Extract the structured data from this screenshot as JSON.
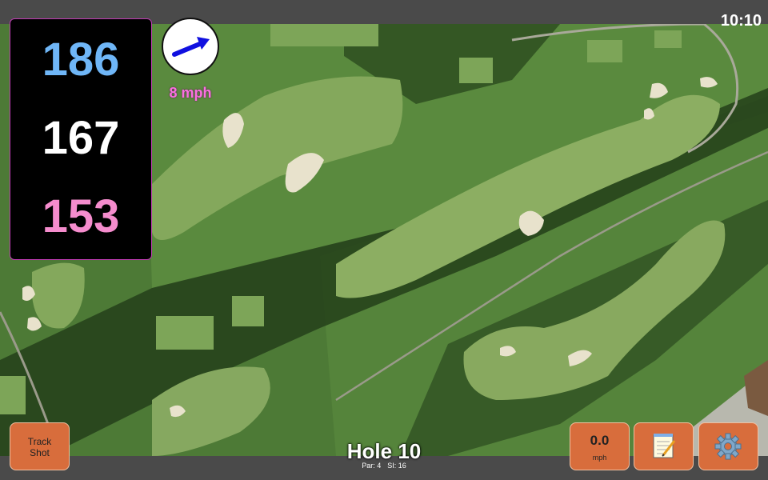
{
  "status_bar": {
    "time": "10:10"
  },
  "distances": {
    "back": "186",
    "middle": "167",
    "front": "153"
  },
  "wind": {
    "speed_label": "8 mph",
    "direction_icon": "arrow-icon",
    "arrow_color": "#1010e0"
  },
  "hole": {
    "title": "Hole 10",
    "par_label": "Par: 4",
    "si_label": "SI: 16"
  },
  "buttons": {
    "track_shot_line1": "Track",
    "track_shot_line2": "Shot",
    "speed_value": "0.0",
    "speed_unit": "mph",
    "notes_icon": "notepad-icon",
    "settings_icon": "gear-icon"
  },
  "colors": {
    "back_distance": "#6fb6f7",
    "middle_distance": "#ffffff",
    "front_distance": "#f58ccd",
    "button_bg": "#d86d3c",
    "panel_border": "#c13bb4",
    "wind_label": "#fa6fe0"
  }
}
